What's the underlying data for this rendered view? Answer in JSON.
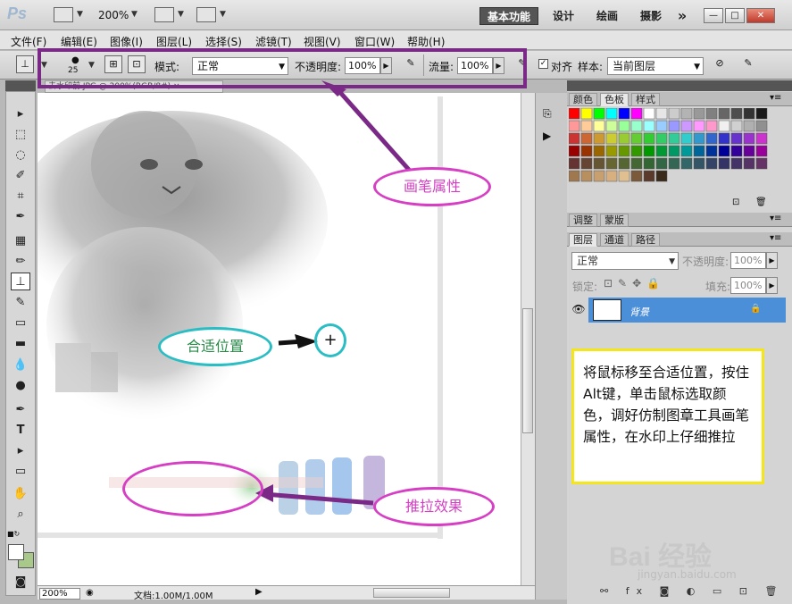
{
  "titlebar": {
    "app_logo": "Ps",
    "zoom": "200%",
    "workspaces": [
      {
        "label": "基本功能",
        "active": true
      },
      {
        "label": "设计",
        "active": false
      },
      {
        "label": "绘画",
        "active": false
      },
      {
        "label": "摄影",
        "active": false
      }
    ],
    "more": "»"
  },
  "menubar": {
    "items": [
      "文件(F)",
      "编辑(E)",
      "图像(I)",
      "图层(L)",
      "选择(S)",
      "滤镜(T)",
      "视图(V)",
      "窗口(W)",
      "帮助(H)"
    ]
  },
  "options": {
    "brush_size": "25",
    "mode_label": "模式:",
    "mode_value": "正常",
    "opacity_label": "不透明度:",
    "opacity_value": "100%",
    "flow_label": "流量:",
    "flow_value": "100%",
    "align_label": "对齐",
    "sample_label": "样本:",
    "sample_value": "当前图层"
  },
  "document": {
    "tab_title": "去水印前.JPG @ 200%(RGB/8#)",
    "status_zoom": "200%",
    "status_doc": "文档:1.00M/1.00M"
  },
  "panels": {
    "color_tabs": [
      "颜色",
      "色板",
      "样式"
    ],
    "adjust_tabs": [
      "调整",
      "蒙版"
    ],
    "layer_tabs": [
      "图层",
      "通道",
      "路径"
    ],
    "blend_mode": "正常",
    "opacity_label": "不透明度:",
    "opacity_value": "100%",
    "lock_label": "锁定:",
    "fill_label": "填充:",
    "fill_value": "100%",
    "layer_name": "背景"
  },
  "annotations": {
    "brush_props": "画笔属性",
    "suitable_pos": "合适位置",
    "push_effect": "推拉效果",
    "instruction": "将鼠标移至合适位置，按住Alt键，单击鼠标选取颜色，调好仿制图章工具画笔属性，在水印上仔细推拉"
  },
  "watermark": {
    "logo": "Bai 经验",
    "url": "jingyan.baidu.com"
  },
  "colors": {
    "highlight": "#7a2a86",
    "oval_brush": "#d63fc4",
    "oval_pos": "#2bbdc4",
    "yellow_box": "#f5e61a",
    "layer_selected": "#4c8fd9"
  }
}
